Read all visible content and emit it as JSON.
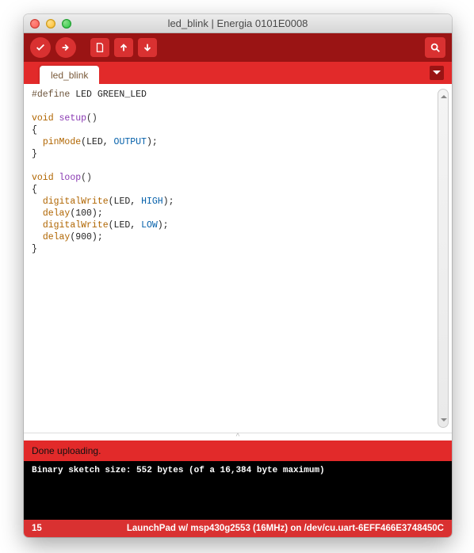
{
  "window": {
    "title": "led_blink | Energia 0101E0008"
  },
  "toolbar": {
    "verify": "Verify",
    "upload": "Upload",
    "new": "New",
    "open": "Open",
    "save": "Save",
    "monitor": "Serial Monitor"
  },
  "tabs": {
    "active": "led_blink"
  },
  "code": {
    "l1_a": "#define",
    "l1_b": " LED GREEN_LED",
    "l2": "",
    "l3_a": "void",
    "l3_b": " ",
    "l3_c": "setup",
    "l3_d": "()",
    "l4": "{",
    "l5_a": "  ",
    "l5_b": "pinMode",
    "l5_c": "(LED, ",
    "l5_d": "OUTPUT",
    "l5_e": ");",
    "l6": "}",
    "l7": "",
    "l8_a": "void",
    "l8_b": " ",
    "l8_c": "loop",
    "l8_d": "()",
    "l9": "{",
    "l10_a": "  ",
    "l10_b": "digitalWrite",
    "l10_c": "(LED, ",
    "l10_d": "HIGH",
    "l10_e": ");",
    "l11_a": "  ",
    "l11_b": "delay",
    "l11_c": "(100);",
    "l12_a": "  ",
    "l12_b": "digitalWrite",
    "l12_c": "(LED, ",
    "l12_d": "LOW",
    "l12_e": ");",
    "l13_a": "  ",
    "l13_b": "delay",
    "l13_c": "(900);",
    "l14": "}"
  },
  "status": {
    "text": "Done uploading."
  },
  "console": {
    "line1": "Binary sketch size: 552 bytes (of a 16,384 byte maximum)"
  },
  "footer": {
    "line": "15",
    "board": "LaunchPad w/ msp430g2553 (16MHz) on /dev/cu.uart-6EFF466E3748450C"
  }
}
